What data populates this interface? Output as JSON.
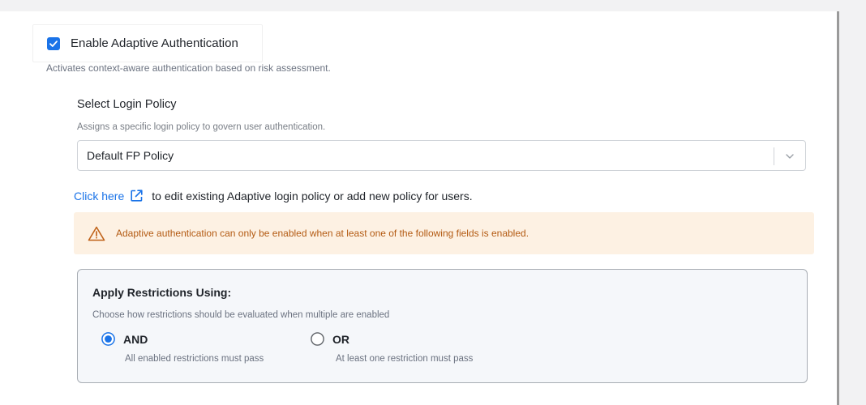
{
  "adaptive_auth": {
    "enabled": true,
    "label": "Enable Adaptive Authentication",
    "description": "Activates context-aware authentication based on risk assessment."
  },
  "login_policy": {
    "title": "Select Login Policy",
    "description": "Assigns a specific login policy to govern user authentication.",
    "selected": "Default FP Policy"
  },
  "policy_link": {
    "link_text": "Click here",
    "rest_text": "to edit existing Adaptive login policy or add new policy for users."
  },
  "warning": {
    "text": "Adaptive authentication can only be enabled when at least one of the following fields is enabled."
  },
  "restrictions": {
    "title": "Apply Restrictions Using:",
    "description": "Choose how restrictions should be evaluated when multiple are enabled",
    "options": [
      {
        "label": "AND",
        "description": "All enabled restrictions must pass",
        "selected": true
      },
      {
        "label": "OR",
        "description": "At least one restriction must pass",
        "selected": false
      }
    ]
  },
  "colors": {
    "accent": "#1a73e8",
    "warning_bg": "#fdf1e3",
    "warning_text": "#b35a12"
  },
  "icons": [
    "checkbox-checked-icon",
    "chevron-down-icon",
    "external-link-icon",
    "warning-triangle-icon",
    "radio-selected-icon",
    "radio-unselected-icon"
  ]
}
